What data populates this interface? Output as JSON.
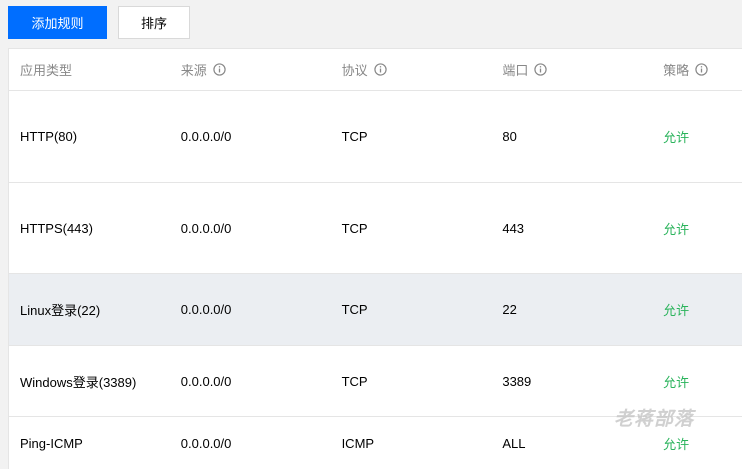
{
  "toolbar": {
    "add_rule_label": "添加规则",
    "sort_label": "排序"
  },
  "table": {
    "headers": [
      "应用类型",
      "来源",
      "协议",
      "端口",
      "策略"
    ],
    "rows": [
      {
        "app": "HTTP(80)",
        "source": "0.0.0.0/0",
        "protocol": "TCP",
        "port": "80",
        "policy": "允许"
      },
      {
        "app": "HTTPS(443)",
        "source": "0.0.0.0/0",
        "protocol": "TCP",
        "port": "443",
        "policy": "允许"
      },
      {
        "app": "Linux登录(22)",
        "source": "0.0.0.0/0",
        "protocol": "TCP",
        "port": "22",
        "policy": "允许"
      },
      {
        "app": "Windows登录(3389)",
        "source": "0.0.0.0/0",
        "protocol": "TCP",
        "port": "3389",
        "policy": "允许"
      },
      {
        "app": "Ping-ICMP",
        "source": "0.0.0.0/0",
        "protocol": "ICMP",
        "port": "ALL",
        "policy": "允许"
      }
    ]
  },
  "watermark": "老蒋部落",
  "colors": {
    "primary": "#006eff",
    "allow": "#29b35b",
    "highlight_row": "#ebeef2"
  },
  "icons": {
    "header_info": "info-circle-icon"
  }
}
